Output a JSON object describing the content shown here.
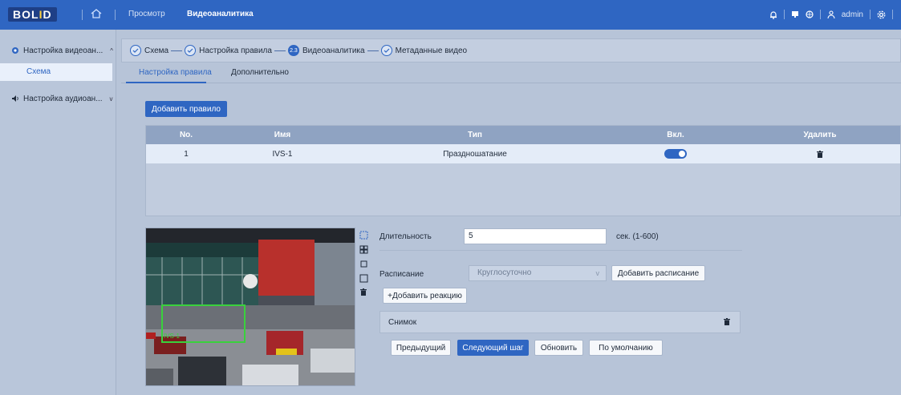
{
  "header": {
    "logo_main": "BOL",
    "logo_accent": "I",
    "logo_end": "D",
    "tabs": [
      {
        "label": "Просмотр",
        "active": false
      },
      {
        "label": "Видеоаналитика",
        "active": true
      }
    ],
    "user": "admin"
  },
  "sidebar": {
    "groups": [
      {
        "label": "Настройка видеоан...",
        "icon": "camera-icon",
        "expanded": true
      },
      {
        "label": "Настройка аудиоан...",
        "icon": "speaker-icon",
        "expanded": false
      }
    ],
    "items": [
      {
        "label": "Схема",
        "active": true
      }
    ]
  },
  "steps": [
    {
      "label": "Схема",
      "state": "done"
    },
    {
      "label": "Настройка правила",
      "state": "done"
    },
    {
      "label": "Видеоаналитика",
      "state": "current",
      "badge": "2.3"
    },
    {
      "label": "Метаданные видео",
      "state": "done"
    }
  ],
  "subtabs": [
    {
      "label": "Настройка правила",
      "active": true
    },
    {
      "label": "Дополнительно",
      "active": false
    }
  ],
  "rules": {
    "add_button": "Добавить правило",
    "columns": [
      "No.",
      "Имя",
      "Тип",
      "Вкл.",
      "Удалить"
    ],
    "rows": [
      {
        "no": "1",
        "name": "IVS-1",
        "type": "Праздношатание",
        "enabled": true
      }
    ]
  },
  "video": {
    "region_label": "IVS-1"
  },
  "form": {
    "duration_label": "Длительность",
    "duration_value": "5",
    "duration_hint": "сек. (1-600)",
    "schedule_label": "Расписание",
    "schedule_value": "Круглосуточно",
    "add_schedule_button": "Добавить расписание",
    "add_reaction_button": "+Добавить реакцию",
    "reaction_item": "Снимок"
  },
  "footer_buttons": {
    "prev": "Предыдущий",
    "next": "Следующий шаг",
    "refresh": "Обновить",
    "default": "По умолчанию"
  },
  "colors": {
    "accent": "#2f66c2",
    "header": "#2f66c2",
    "background": "#b7c4d8",
    "roi": "#39d13c"
  }
}
